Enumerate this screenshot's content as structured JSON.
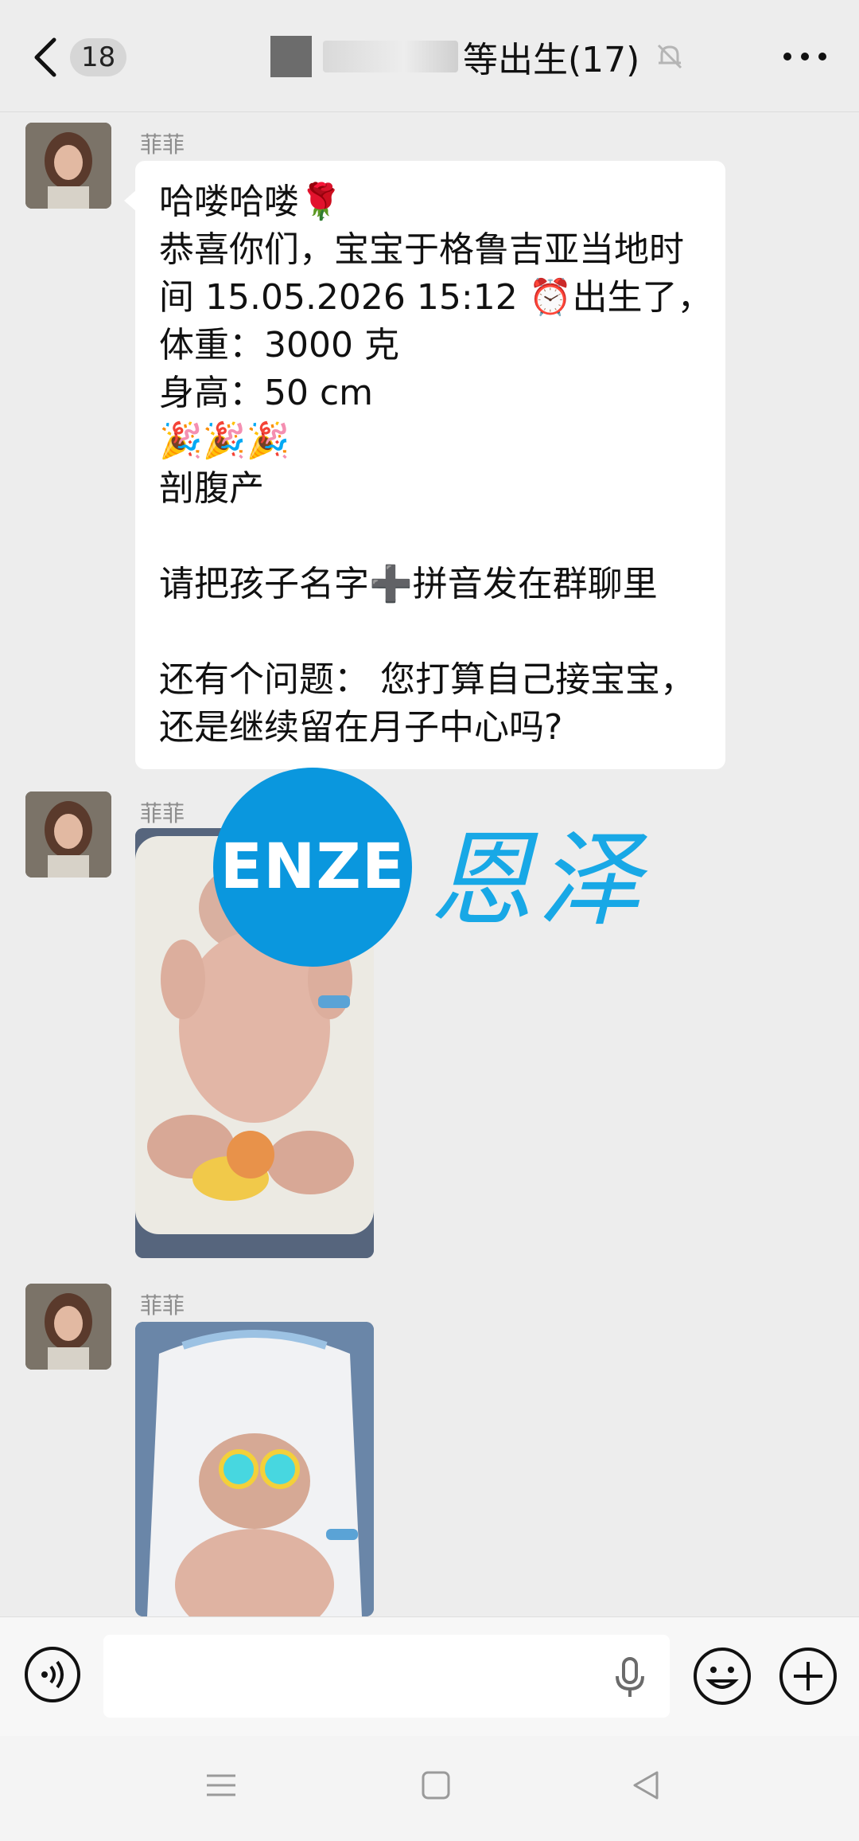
{
  "header": {
    "unread_count": "18",
    "title_visible": "等出生(17)"
  },
  "messages": [
    {
      "sender": "菲菲",
      "lines": [
        "哈喽哈喽🌹",
        "恭喜你们，宝宝于格鲁吉亚当地时",
        "间 15.05.2026 15:12 ⏰出生了，",
        "体重：3000 克",
        "身高：50 cm",
        "🎉🎉🎉",
        "剖腹产",
        "",
        "请把孩子名字➕拼音发在群聊里",
        "",
        "还有个问题： 您打算自己接宝宝，",
        "还是继续留在月子中心吗?"
      ]
    },
    {
      "sender": "菲菲",
      "type": "image"
    },
    {
      "sender": "菲菲",
      "type": "image"
    }
  ],
  "watermark": {
    "logo_text": "ENZE",
    "cn_text": "恩泽"
  },
  "colors": {
    "background": "#ededed",
    "bubble": "#ffffff",
    "watermark": "#0a97de"
  },
  "icons": [
    "back-icon",
    "mute-bell-icon",
    "more-icon",
    "voice-icon",
    "microphone-icon",
    "emoji-icon",
    "plus-icon",
    "nav-menu-icon",
    "nav-home-icon",
    "nav-back-icon"
  ]
}
